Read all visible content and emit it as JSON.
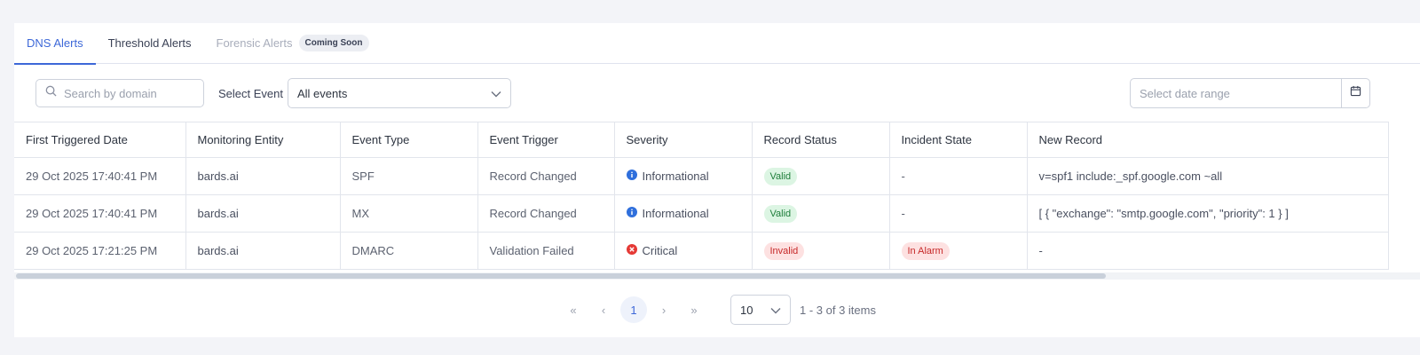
{
  "tabs": [
    {
      "label": "DNS Alerts"
    },
    {
      "label": "Threshold Alerts"
    },
    {
      "label": "Forensic Alerts",
      "badge": "Coming Soon"
    }
  ],
  "filters": {
    "search_placeholder": "Search by domain",
    "event_label": "Select Event",
    "event_value": "All events",
    "date_placeholder": "Select date range"
  },
  "table": {
    "columns": [
      "First Triggered Date",
      "Monitoring Entity",
      "Event Type",
      "Event Trigger",
      "Severity",
      "Record Status",
      "Incident State",
      "New Record"
    ],
    "rows": [
      {
        "date": "29 Oct 2025 17:40:41 PM",
        "entity": "bards.ai",
        "type": "SPF",
        "trigger": "Record Changed",
        "severity": "Informational",
        "status": "Valid",
        "incident": "-",
        "new_record": "v=spf1 include:_spf.google.com ~all"
      },
      {
        "date": "29 Oct 2025 17:40:41 PM",
        "entity": "bards.ai",
        "type": "MX",
        "trigger": "Record Changed",
        "severity": "Informational",
        "status": "Valid",
        "incident": "-",
        "new_record": "[ { \"exchange\": \"smtp.google.com\", \"priority\": 1 } ]"
      },
      {
        "date": "29 Oct 2025 17:21:25 PM",
        "entity": "bards.ai",
        "type": "DMARC",
        "trigger": "Validation Failed",
        "severity": "Critical",
        "status": "Invalid",
        "incident": "In Alarm",
        "new_record": "-"
      }
    ]
  },
  "pagination": {
    "first": "«",
    "prev": "‹",
    "current_page": "1",
    "next": "›",
    "last": "»",
    "page_size": "10",
    "items_info": "1 - 3 of 3 items"
  },
  "colors": {
    "accent": "#3d68d8",
    "info": "#2f6fdc",
    "critical": "#e53935"
  }
}
